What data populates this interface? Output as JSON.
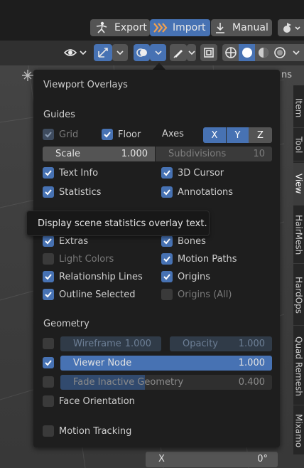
{
  "header": {
    "export_label": "Export",
    "import_label": "Import",
    "manual_label": "Manual"
  },
  "sidebar_tabs": [
    "Item",
    "Tool",
    "View",
    "HairMesh",
    "HardOps",
    "Quad Remesh",
    "Mixamo"
  ],
  "sidebar_partial_label": "ns",
  "bottom_field": {
    "label": "X",
    "value": "0°"
  },
  "overlays": {
    "title": "Viewport Overlays",
    "guides": {
      "heading": "Guides",
      "grid_label": "Grid",
      "floor_label": "Floor",
      "axes_label": "Axes",
      "axes": [
        "X",
        "Y",
        "Z"
      ],
      "scale_label": "Scale",
      "scale_value": "1.000",
      "subdivisions_label": "Subdivisions",
      "subdivisions_value": "10",
      "text_info_label": "Text Info",
      "cursor_label": "3D Cursor",
      "statistics_label": "Statistics",
      "annotations_label": "Annotations"
    },
    "objects": {
      "extras_label": "Extras",
      "bones_label": "Bones",
      "light_colors_label": "Light Colors",
      "motion_paths_label": "Motion Paths",
      "relationship_lines_label": "Relationship Lines",
      "origins_label": "Origins",
      "outline_selected_label": "Outline Selected",
      "origins_all_label": "Origins (All)"
    },
    "geometry": {
      "heading": "Geometry",
      "wireframe_label": "Wireframe",
      "wireframe_value": "1.000",
      "opacity_label": "Opacity",
      "opacity_value": "1.000",
      "viewer_node_label": "Viewer Node",
      "viewer_node_value": "1.000",
      "fade_inactive_label": "Fade Inactive Geometry",
      "fade_inactive_value": "0.400",
      "fade_inactive_fraction": 0.4,
      "face_orientation_label": "Face Orientation",
      "motion_tracking_label": "Motion Tracking"
    }
  },
  "tooltip": {
    "text": "Display scene statistics overlay text."
  },
  "colors": {
    "accent": "#4772b3",
    "popover_bg": "#1e1e1e",
    "button_bg": "#545454"
  }
}
